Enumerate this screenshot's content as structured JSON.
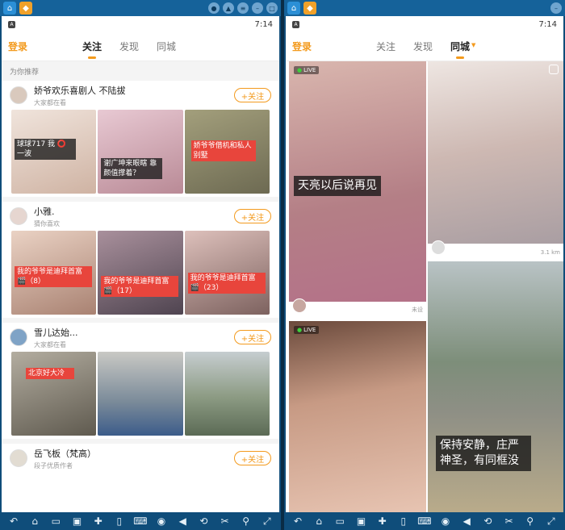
{
  "left": {
    "status": {
      "time": "7:14"
    },
    "header": {
      "login": "登录",
      "tabs": [
        "关注",
        "发现",
        "同城"
      ],
      "active_tab": "关注"
    },
    "reco_label": "为你推荐",
    "users": [
      {
        "name": "娇爷欢乐喜剧人 不陆拔",
        "sub": "大家都在看",
        "follow": "+关注",
        "thumbs": [
          {
            "caption": "球球717 我 ⭕ 一波",
            "style": "dark",
            "bg": "#e9ddd6"
          },
          {
            "caption": "谢广坤来眼瞎 靠颜值撑着？",
            "style": "dark",
            "bg": "#d8b7c2"
          },
          {
            "caption": "娇爷爷借机和私人 别墅",
            "style": "red",
            "bg": "#8c8a6a"
          }
        ]
      },
      {
        "name": "小雅.",
        "sub": "猜你喜欢",
        "follow": "+关注",
        "thumbs": [
          {
            "caption": "我的爷爷是迪拜首富 🎬（8）",
            "style": "red",
            "bg": "#cda79a"
          },
          {
            "caption": "我的爷爷是迪拜首富 🎬（17）",
            "style": "red",
            "bg": "#7c6d76"
          },
          {
            "caption": "我的爷爷是迪拜首富 🎬（23）",
            "style": "red",
            "bg": "#c3a09c"
          }
        ]
      },
      {
        "name": "雪儿达始...",
        "sub": "大家都在看",
        "follow": "+关注",
        "thumbs": [
          {
            "caption": "北京好大冷",
            "style": "red",
            "bg": "#8d8a7d"
          },
          {
            "caption": "",
            "style": "dark",
            "bg": "#8d8c7a"
          },
          {
            "caption": "",
            "style": "dark",
            "bg": "#9aa096"
          }
        ]
      },
      {
        "name": "岳飞板（梵高）",
        "sub": "段子优质作者",
        "follow": "+关注",
        "thumbs": []
      }
    ]
  },
  "right": {
    "status": {
      "time": "7:14"
    },
    "header": {
      "login": "登录",
      "tabs": [
        "关注",
        "发现",
        "同城"
      ],
      "active_tab": "同城"
    },
    "cards": [
      {
        "live": "LIVE",
        "caption": "天亮以后说再见",
        "dist": "未设",
        "bg": "#c9a39c"
      },
      {
        "live": "",
        "caption": "",
        "dist": "3.1 km",
        "bg": "#e6dfdc"
      },
      {
        "live": "LIVE",
        "caption": "",
        "dist": "",
        "bg": "#d6a791"
      },
      {
        "live": "",
        "caption": "保持安静，庄严 神圣，有同框没",
        "dist": "",
        "bg": "#7d8a76"
      }
    ]
  },
  "colors": {
    "accent": "#f39a1d",
    "frame": "#0f4d7a"
  }
}
